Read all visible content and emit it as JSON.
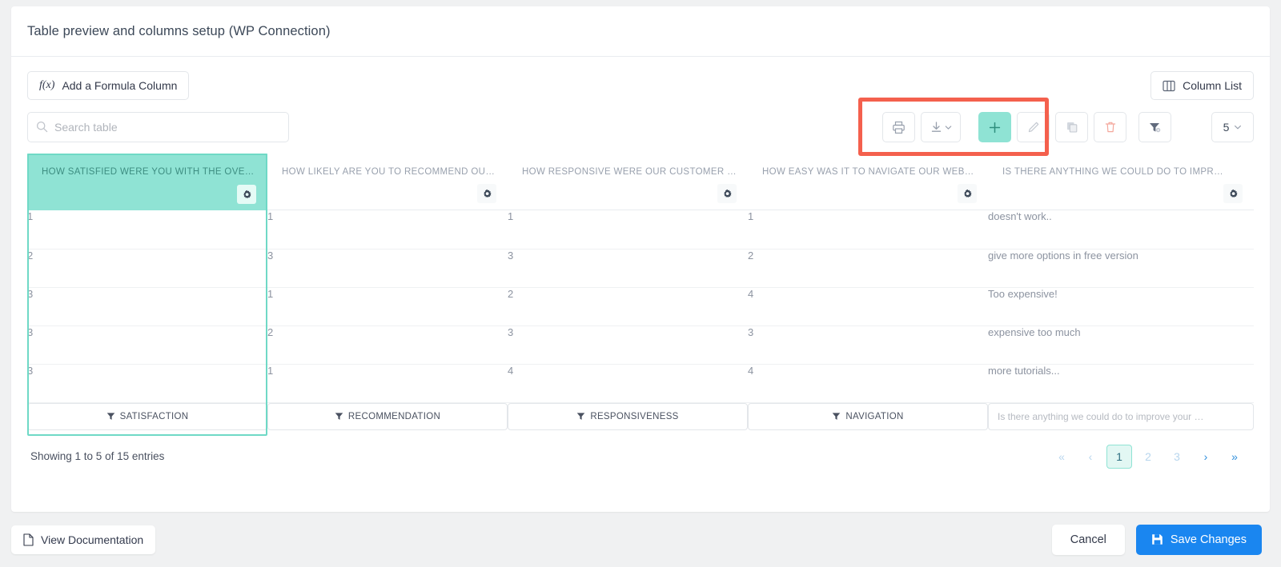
{
  "header": {
    "title": "Table preview and columns setup (WP Connection)"
  },
  "toolbar": {
    "formula_button_label": "Add a Formula Column",
    "formula_icon_text": "f(x)",
    "column_list_label": "Column List",
    "column_list_icon": "columns-icon",
    "search_placeholder": "Search table",
    "search_value": "",
    "search_icon": "search-icon",
    "print_icon": "print-icon",
    "export_icon": "download-icon",
    "add_icon": "plus-icon",
    "edit_icon": "pencil-icon",
    "duplicate_icon": "copy-icon",
    "delete_icon": "trash-icon",
    "filter_icon": "funnel-settings-icon",
    "page_size_value": "5",
    "page_size_caret": "chevron-down-icon",
    "highlight_color": "#f4604d",
    "accent_color": "#8fe3d4"
  },
  "table": {
    "columns": [
      {
        "header": "HOW SATISFIED WERE YOU WITH THE OVERA…",
        "filter_label": "SATISFACTION",
        "filter_type": "button",
        "selected": true
      },
      {
        "header": "HOW LIKELY ARE YOU TO RECOMMEND OUR …",
        "filter_label": "RECOMMENDATION",
        "filter_type": "button",
        "selected": false
      },
      {
        "header": "HOW RESPONSIVE WERE OUR CUSTOMER SE…",
        "filter_label": "RESPONSIVENESS",
        "filter_type": "button",
        "selected": false
      },
      {
        "header": "HOW EASY WAS IT TO NAVIGATE OUR WEBSI…",
        "filter_label": "NAVIGATION",
        "filter_type": "button",
        "selected": false
      },
      {
        "header": "IS THERE ANYTHING WE COULD DO TO IMPR…",
        "filter_placeholder": "Is there anything we could do to improve your …",
        "filter_type": "input",
        "filter_value": "",
        "selected": false
      }
    ],
    "rows": [
      [
        "1",
        "1",
        "1",
        "1",
        "doesn't work.."
      ],
      [
        "2",
        "3",
        "3",
        "2",
        "give more options in free version"
      ],
      [
        "3",
        "1",
        "2",
        "4",
        "Too expensive!"
      ],
      [
        "3",
        "2",
        "3",
        "3",
        "expensive too much"
      ],
      [
        "3",
        "1",
        "4",
        "4",
        "more tutorials..."
      ]
    ],
    "gear_icon": "gear-icon",
    "filter_icon": "funnel-icon"
  },
  "footer": {
    "entries_text": "Showing 1 to 5 of 15 entries",
    "pagination": {
      "first_label": "«",
      "prev_label": "‹",
      "pages": [
        "1",
        "2",
        "3"
      ],
      "current_page": "1",
      "next_label": "›",
      "last_label": "»"
    }
  },
  "bottom_bar": {
    "documentation_label": "View Documentation",
    "documentation_icon": "file-icon",
    "cancel_label": "Cancel",
    "save_label": "Save Changes",
    "save_icon": "floppy-disk-icon",
    "save_color": "#1a86f0"
  }
}
